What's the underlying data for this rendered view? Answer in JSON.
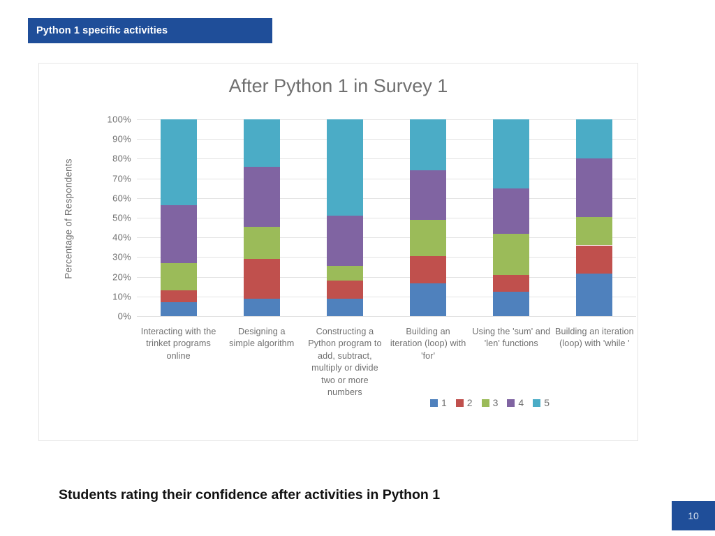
{
  "slide": {
    "title": "Python 1 specific activities",
    "caption": "Students rating their confidence after activities in Python 1",
    "page_number": "10",
    "banner_color": "#1F4E99"
  },
  "chart_data": {
    "type": "bar",
    "stacked": true,
    "title": "After Python 1 in Survey 1",
    "xlabel": "",
    "ylabel": "Percentage of Respondents",
    "ylim": [
      0,
      100
    ],
    "grid": true,
    "legend_position": "bottom-right",
    "ytick_labels": [
      "100%",
      "90%",
      "80%",
      "70%",
      "60%",
      "50%",
      "40%",
      "30%",
      "20%",
      "10%",
      "0%"
    ],
    "ytick_values": [
      100,
      90,
      80,
      70,
      60,
      50,
      40,
      30,
      20,
      10,
      0
    ],
    "categories": [
      "Interacting with the trinket programs online",
      "Designing a simple algorithm",
      "Constructing a Python program to add, subtract, multiply or divide two or more numbers",
      "Building an iteration (loop) with 'for'",
      "Using the 'sum' and 'len' functions",
      "Building an iteration (loop) with 'while '"
    ],
    "series": [
      {
        "name": "1",
        "color": "#4F81BD",
        "values": [
          7,
          9,
          9,
          16.5,
          12.5,
          21.5
        ]
      },
      {
        "name": "2",
        "color": "#C0504D",
        "values": [
          6,
          20,
          9,
          14,
          8.5,
          14.5
        ]
      },
      {
        "name": "3",
        "color": "#9BBB59",
        "values": [
          14,
          16.5,
          7.5,
          18.5,
          21,
          14.5
        ]
      },
      {
        "name": "4",
        "color": "#8064A2",
        "values": [
          29.5,
          30.5,
          25.5,
          25,
          23,
          29.5
        ]
      },
      {
        "name": "5",
        "color": "#4BACC6",
        "values": [
          43.5,
          24,
          49,
          26,
          35,
          20
        ]
      }
    ],
    "legend": [
      {
        "label": "1",
        "color": "#4F81BD"
      },
      {
        "label": "2",
        "color": "#C0504D"
      },
      {
        "label": "3",
        "color": "#9BBB59"
      },
      {
        "label": "4",
        "color": "#8064A2"
      },
      {
        "label": "5",
        "color": "#4BACC6"
      }
    ]
  }
}
